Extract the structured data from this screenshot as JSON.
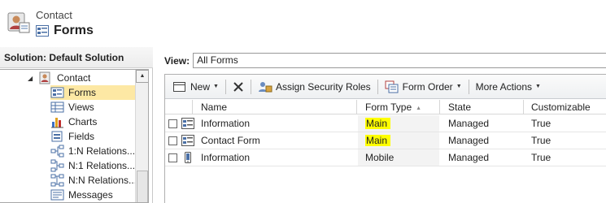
{
  "header": {
    "entity": "Contact",
    "title": "Forms"
  },
  "left_pane": {
    "solution_label": "Solution: Default Solution",
    "tree": {
      "parent": "Contact",
      "items": [
        {
          "label": "Forms",
          "icon": "forms-icon",
          "selected": true
        },
        {
          "label": "Views",
          "icon": "views-icon"
        },
        {
          "label": "Charts",
          "icon": "charts-icon"
        },
        {
          "label": "Fields",
          "icon": "fields-icon"
        },
        {
          "label": "1:N Relations...",
          "icon": "relationship-1n-icon"
        },
        {
          "label": "N:1 Relations...",
          "icon": "relationship-n1-icon"
        },
        {
          "label": "N:N Relations...",
          "icon": "relationship-nn-icon"
        },
        {
          "label": "Messages",
          "icon": "messages-icon"
        }
      ]
    }
  },
  "view": {
    "label": "View:",
    "value": "All Forms"
  },
  "toolbar": {
    "new_label": "New",
    "delete_icon": "delete-x-icon",
    "assign_security_roles_label": "Assign Security Roles",
    "form_order_label": "Form Order",
    "more_actions_label": "More Actions"
  },
  "grid": {
    "columns": [
      "Name",
      "Form Type",
      "State",
      "Customizable"
    ],
    "sorted_column": "Form Type",
    "rows": [
      {
        "name": "Information",
        "form_type": "Main",
        "state": "Managed",
        "customizable": "True",
        "icon": "main-form-icon",
        "highlight": true
      },
      {
        "name": "Contact Form",
        "form_type": "Main",
        "state": "Managed",
        "customizable": "True",
        "icon": "main-form-icon",
        "highlight": true
      },
      {
        "name": "Information",
        "form_type": "Mobile",
        "state": "Managed",
        "customizable": "True",
        "icon": "mobile-form-icon",
        "highlight": false
      }
    ]
  },
  "colors": {
    "selected_tree_bg": "#fde8a4",
    "highlight": "#ffff00"
  }
}
